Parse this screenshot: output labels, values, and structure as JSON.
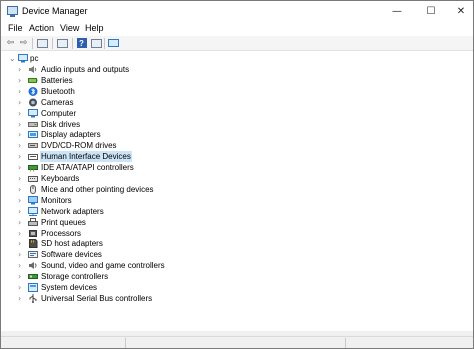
{
  "window": {
    "title": "Device Manager"
  },
  "window_controls": {
    "minimize": "—",
    "maximize": "☐",
    "close": "✕"
  },
  "menu": [
    "File",
    "Action",
    "View",
    "Help"
  ],
  "toolbar": {
    "back": "⇦",
    "forward": "⇨",
    "help": "?"
  },
  "tree": {
    "root": "pc",
    "items": [
      {
        "label": "Audio inputs and outputs",
        "icon": "speaker-icon"
      },
      {
        "label": "Batteries",
        "icon": "battery-icon"
      },
      {
        "label": "Bluetooth",
        "icon": "bluetooth-icon"
      },
      {
        "label": "Cameras",
        "icon": "camera-icon"
      },
      {
        "label": "Computer",
        "icon": "computer-icon"
      },
      {
        "label": "Disk drives",
        "icon": "disk-drive-icon"
      },
      {
        "label": "Display adapters",
        "icon": "display-adapter-icon"
      },
      {
        "label": "DVD/CD-ROM drives",
        "icon": "dvd-drive-icon"
      },
      {
        "label": "Human Interface Devices",
        "icon": "hid-icon",
        "selected": true
      },
      {
        "label": "IDE ATA/ATAPI controllers",
        "icon": "ide-controller-icon"
      },
      {
        "label": "Keyboards",
        "icon": "keyboard-icon"
      },
      {
        "label": "Mice and other pointing devices",
        "icon": "mouse-icon"
      },
      {
        "label": "Monitors",
        "icon": "monitor-icon"
      },
      {
        "label": "Network adapters",
        "icon": "network-adapter-icon"
      },
      {
        "label": "Print queues",
        "icon": "printer-icon"
      },
      {
        "label": "Processors",
        "icon": "processor-icon"
      },
      {
        "label": "SD host adapters",
        "icon": "sd-card-icon"
      },
      {
        "label": "Software devices",
        "icon": "software-device-icon"
      },
      {
        "label": "Sound, video and game controllers",
        "icon": "sound-icon"
      },
      {
        "label": "Storage controllers",
        "icon": "storage-controller-icon"
      },
      {
        "label": "System devices",
        "icon": "system-device-icon"
      },
      {
        "label": "Universal Serial Bus controllers",
        "icon": "usb-icon"
      }
    ]
  },
  "colors": {
    "selection": "#cce4f7",
    "toolbar_blue": "#2d5fae"
  }
}
